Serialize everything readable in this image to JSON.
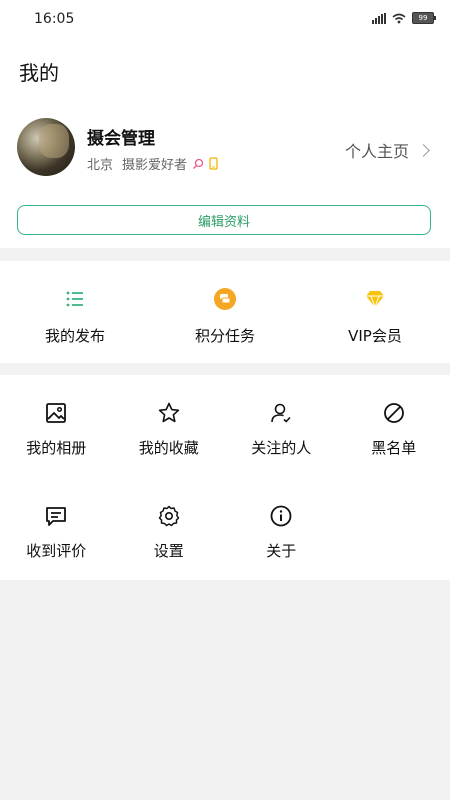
{
  "status": {
    "time": "16:05",
    "battery": "99"
  },
  "page_title": "我的",
  "profile": {
    "name": "摄会管理",
    "location": "北京",
    "role": "摄影爱好者",
    "homepage_label": "个人主页"
  },
  "edit_button": "编辑资料",
  "quick_actions": [
    {
      "label": "我的发布",
      "icon": "list-icon"
    },
    {
      "label": "积分任务",
      "icon": "coins-icon"
    },
    {
      "label": "VIP会员",
      "icon": "diamond-icon"
    }
  ],
  "menu": [
    {
      "label": "我的相册",
      "icon": "image-icon"
    },
    {
      "label": "我的收藏",
      "icon": "star-icon"
    },
    {
      "label": "关注的人",
      "icon": "user-check-icon"
    },
    {
      "label": "黑名单",
      "icon": "block-icon"
    },
    {
      "label": "收到评价",
      "icon": "comment-icon"
    },
    {
      "label": "设置",
      "icon": "gear-icon"
    },
    {
      "label": "关于",
      "icon": "info-icon"
    }
  ],
  "colors": {
    "accent": "#36b37e",
    "coin": "#f5a623",
    "vip": "#f8c30a"
  }
}
